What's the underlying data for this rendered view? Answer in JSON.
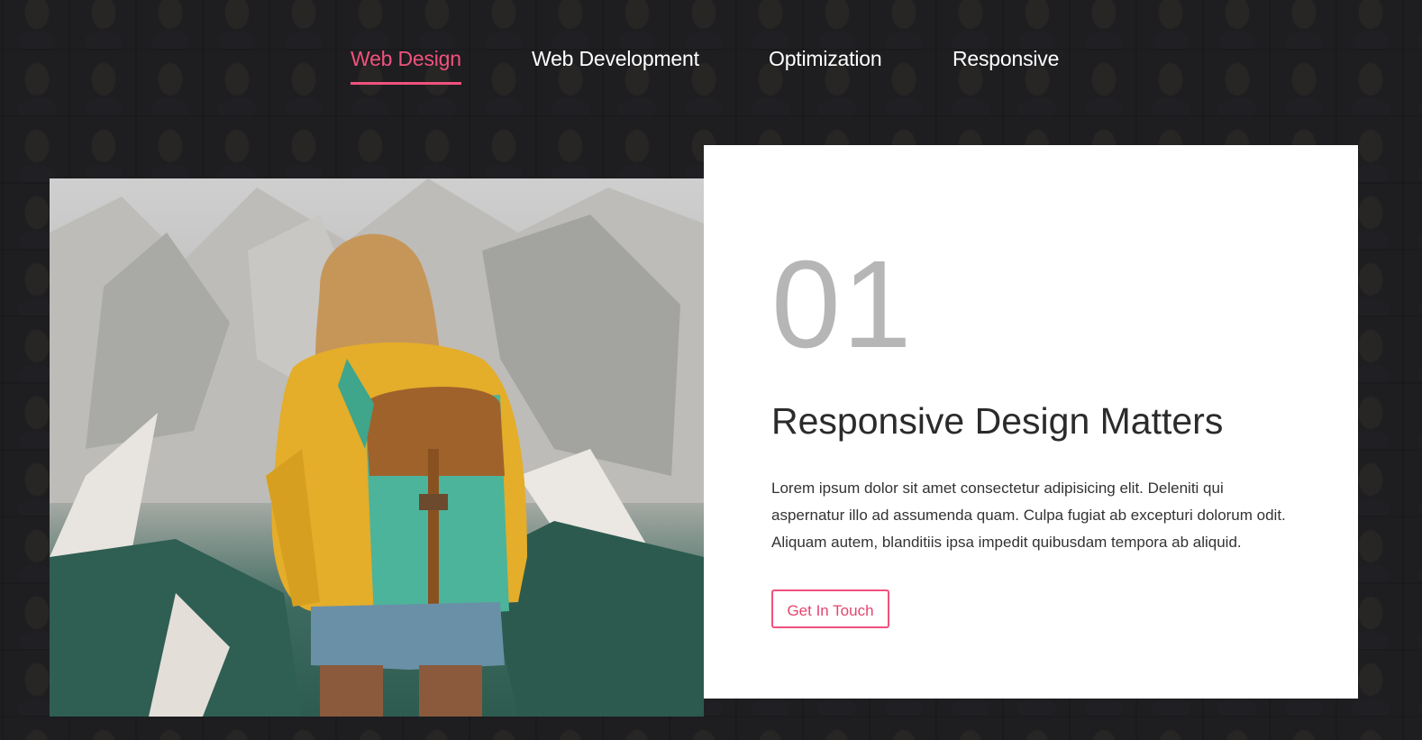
{
  "tabs": [
    {
      "label": "Web Design",
      "active": true
    },
    {
      "label": "Web Development",
      "active": false
    },
    {
      "label": "Optimization",
      "active": false
    },
    {
      "label": "Responsive",
      "active": false
    }
  ],
  "card": {
    "number": "01",
    "title": "Responsive Design Matters",
    "body": "Lorem ipsum dolor sit amet consectetur adipisicing elit. Deleniti qui aspernatur illo ad assumenda quam. Culpa fugiat ab excepturi dolorum odit. Aliquam autem, blanditiis ipsa impedit quibusdam tempora ab aliquid.",
    "cta_label": "Get In Touch"
  },
  "colors": {
    "accent": "#f0527e",
    "background": "#1b1b1c",
    "card": "#ffffff",
    "number": "#b6b6b6"
  },
  "photo": {
    "subject": "hiker-with-backpack-icon"
  }
}
